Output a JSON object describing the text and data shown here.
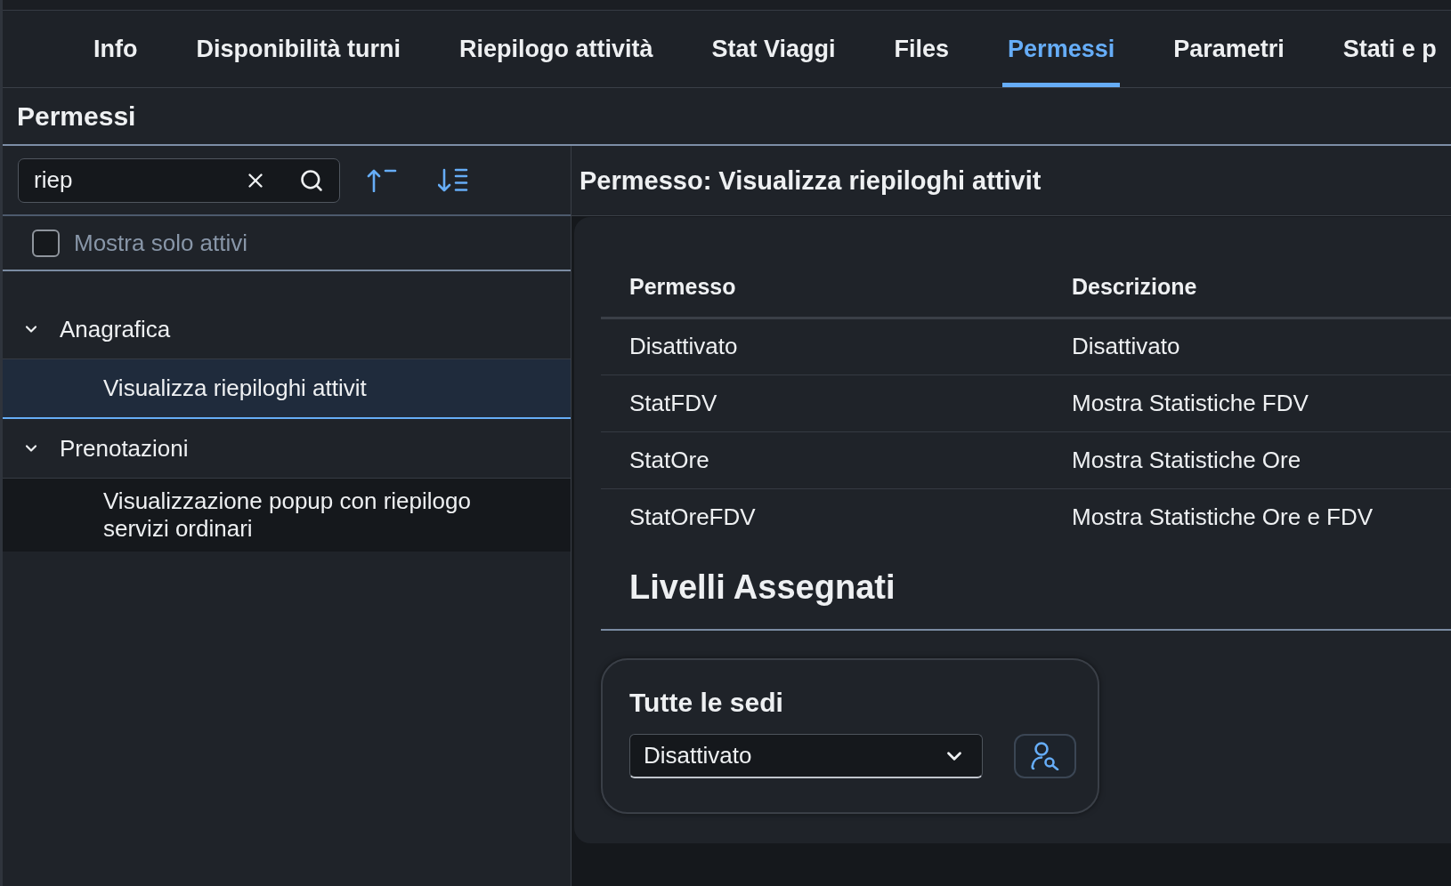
{
  "tabs": [
    {
      "label": "Info",
      "selected": false
    },
    {
      "label": "Disponibilità turni",
      "selected": false
    },
    {
      "label": "Riepilogo attività",
      "selected": false
    },
    {
      "label": "Stat Viaggi",
      "selected": false
    },
    {
      "label": "Files",
      "selected": false
    },
    {
      "label": "Permessi",
      "selected": true
    },
    {
      "label": "Parametri",
      "selected": false
    },
    {
      "label": "Stati e p",
      "selected": false
    }
  ],
  "page_title": "Permessi",
  "sidebar": {
    "search": {
      "value": "riep"
    },
    "filter": {
      "label": "Mostra solo attivi",
      "checked": false
    },
    "tree": [
      {
        "label": "Anagrafica",
        "expanded": true,
        "children": [
          {
            "label": "Visualizza riepiloghi attivit",
            "selected": true,
            "hovered": false
          }
        ]
      },
      {
        "label": "Prenotazioni",
        "expanded": true,
        "children": [
          {
            "label": "Visualizzazione popup con riepilogo servizi ordinari",
            "selected": false,
            "hovered": true
          }
        ]
      }
    ]
  },
  "detail": {
    "title": "Permesso: Visualizza riepiloghi attivit",
    "table": {
      "columns": [
        "Permesso",
        "Descrizione"
      ],
      "rows": [
        [
          "Disattivato",
          "Disattivato"
        ],
        [
          "StatFDV",
          "Mostra Statistiche FDV"
        ],
        [
          "StatOre",
          "Mostra Statistiche Ore"
        ],
        [
          "StatOreFDV",
          "Mostra Statistiche Ore e FDV"
        ]
      ]
    },
    "levels_heading": "Livelli Assegnati",
    "levels": [
      {
        "label": "Tutte le sedi",
        "value": "Disattivato"
      }
    ]
  }
}
